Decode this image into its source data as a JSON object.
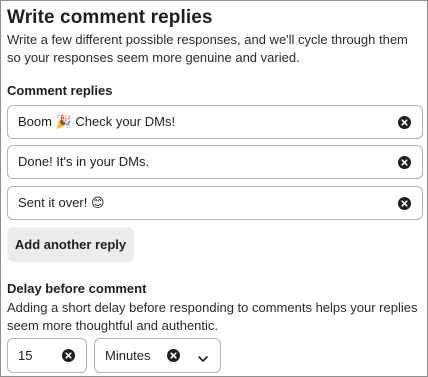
{
  "header": {
    "title": "Write comment replies",
    "description": "Write a few different possible responses, and we'll cycle through them so your responses seem more genuine and varied."
  },
  "replies": {
    "label": "Comment replies",
    "items": [
      {
        "value": "Boom 🎉 Check your DMs!"
      },
      {
        "value": "Done! It's in  your DMs."
      },
      {
        "value": "Sent it over! 😊"
      }
    ],
    "add_label": "Add another reply"
  },
  "delay": {
    "label": "Delay before comment",
    "description": "Adding a short delay before responding to comments helps your replies seem more thoughtful and authentic.",
    "amount": "15",
    "unit": "Minutes"
  },
  "icons": {
    "clear": "close-circle-icon",
    "dropdown": "chevron-down-icon"
  },
  "colors": {
    "text": "#1f1f1f",
    "border": "#b4b4b4",
    "button_bg": "#ececec"
  }
}
